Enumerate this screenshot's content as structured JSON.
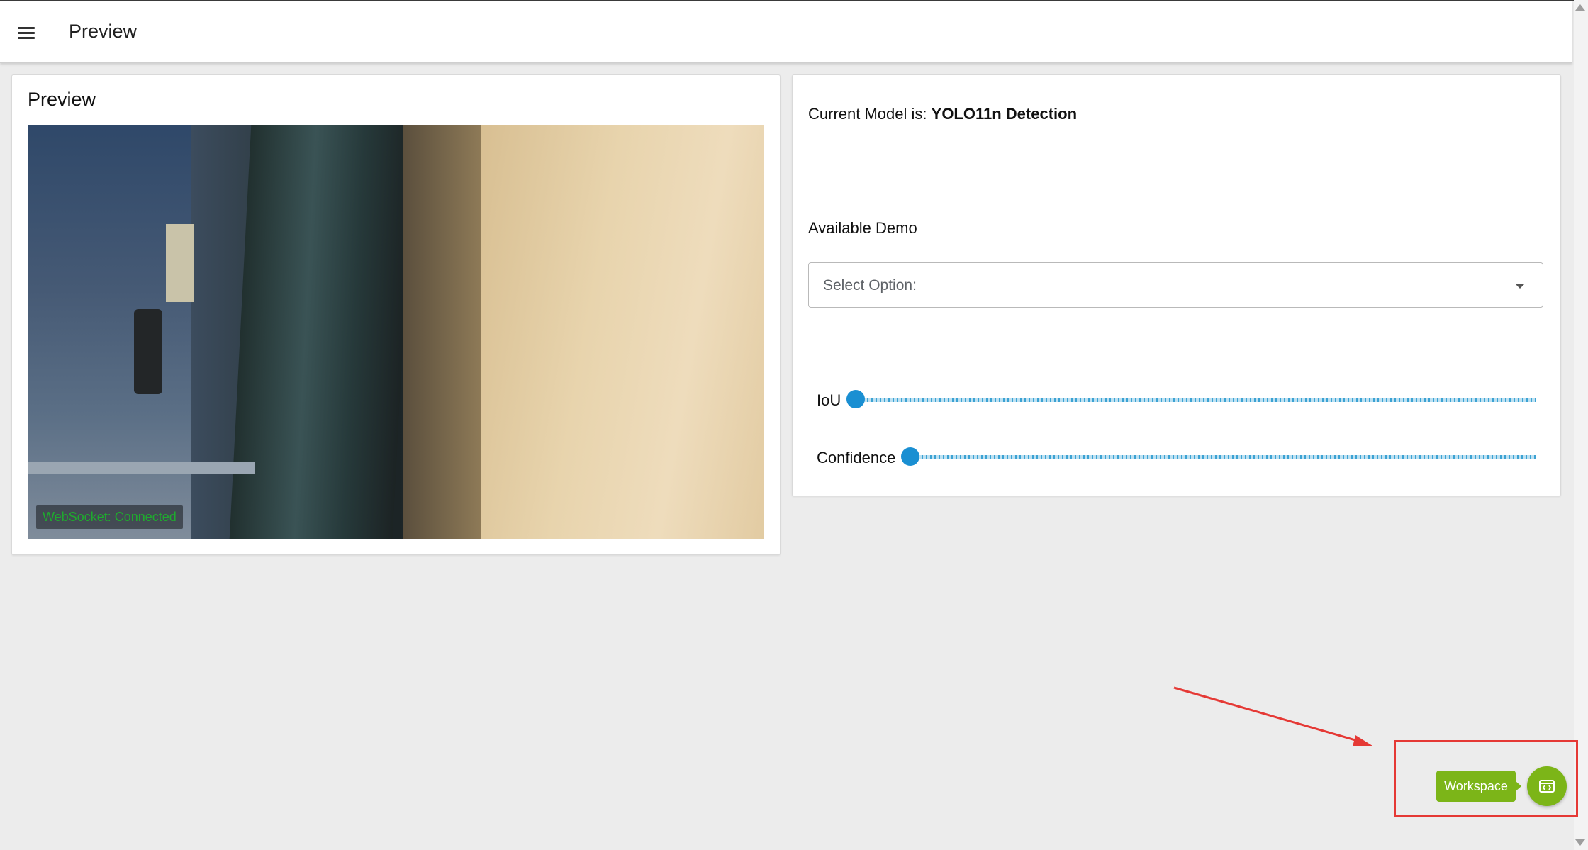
{
  "appbar": {
    "title": "Preview"
  },
  "preview": {
    "title": "Preview",
    "ws_status": "WebSocket: Connected"
  },
  "model": {
    "prefix": "Current Model is:",
    "name": "YOLO11n Detection",
    "demo_label": "Available Demo",
    "select_placeholder": "Select Option:"
  },
  "sliders": [
    {
      "label": "IoU",
      "value": 0
    },
    {
      "label": "Confidence",
      "value": 0
    }
  ],
  "workspace": {
    "label": "Workspace"
  },
  "colors": {
    "accent_green": "#7cb518",
    "slider_blue": "#1a8fd2",
    "annotation_red": "#e53935",
    "ws_status_green": "#1faa2e"
  }
}
